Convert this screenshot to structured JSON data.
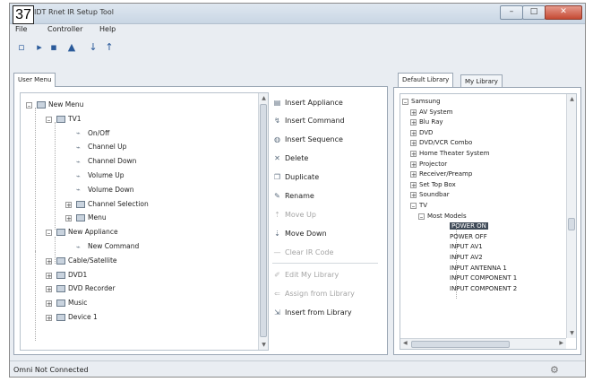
{
  "badge": "37",
  "window": {
    "title": "IDT Rnet IR Setup Tool",
    "controls": {
      "minimize": "–",
      "maximize": "□",
      "close": "✕"
    }
  },
  "menu": [
    "File",
    "Controller",
    "Help"
  ],
  "toolbar": [
    {
      "icon": "new-document-icon",
      "glyph": "▫"
    },
    {
      "icon": "open-icon",
      "glyph": "▸"
    },
    {
      "icon": "save-icon",
      "glyph": "▪"
    },
    {
      "icon": "upload-device-icon",
      "glyph": "▲"
    },
    {
      "icon": "arrow-down-icon",
      "glyph": "↓"
    },
    {
      "icon": "arrow-up-icon",
      "glyph": "↑"
    }
  ],
  "left_tab": "User Menu",
  "user_tree": [
    {
      "label": "New Menu",
      "type": "folder",
      "expander": "–"
    },
    {
      "label": "TV1",
      "type": "folder",
      "expander": "–"
    },
    {
      "label": "On/Off",
      "type": "command"
    },
    {
      "label": "Channel Up",
      "type": "command"
    },
    {
      "label": "Channel Down",
      "type": "command"
    },
    {
      "label": "Volume Up",
      "type": "command"
    },
    {
      "label": "Volume Down",
      "type": "command"
    },
    {
      "label": "Channel Selection",
      "type": "folder",
      "expander": "+"
    },
    {
      "label": "Menu",
      "type": "folder",
      "expander": "+"
    },
    {
      "label": "New Appliance",
      "type": "folder",
      "expander": "–"
    },
    {
      "label": "New Command",
      "type": "command"
    },
    {
      "label": "Cable/Satellite",
      "type": "folder",
      "expander": "+"
    },
    {
      "label": "DVD1",
      "type": "folder",
      "expander": "+"
    },
    {
      "label": "DVD Recorder",
      "type": "folder",
      "expander": "+"
    },
    {
      "label": "Music",
      "type": "folder",
      "expander": "+"
    },
    {
      "label": "Device 1",
      "type": "folder",
      "expander": "+"
    }
  ],
  "actions": [
    {
      "label": "Insert Appliance",
      "icon": "insert-appliance-icon",
      "glyph": "▤",
      "enabled": true
    },
    {
      "label": "Insert Command",
      "icon": "insert-command-icon",
      "glyph": "↯",
      "enabled": true
    },
    {
      "label": "Insert Sequence",
      "icon": "insert-sequence-icon",
      "glyph": "◍",
      "enabled": true
    },
    {
      "label": "Delete",
      "icon": "delete-icon",
      "glyph": "✕",
      "enabled": true
    },
    {
      "label": "Duplicate",
      "icon": "duplicate-icon",
      "glyph": "❐",
      "enabled": true
    },
    {
      "label": "Rename",
      "icon": "rename-icon",
      "glyph": "✎",
      "enabled": true
    },
    {
      "label": "Move Up",
      "icon": "move-up-icon",
      "glyph": "⇡",
      "enabled": false
    },
    {
      "label": "Move Down",
      "icon": "move-down-icon",
      "glyph": "⇣",
      "enabled": true
    },
    {
      "label": "Clear IR Code",
      "icon": "clear-ir-code-icon",
      "glyph": "—",
      "enabled": false
    },
    {
      "label": "Edit My Library",
      "icon": "edit-library-icon",
      "glyph": "✐",
      "enabled": false
    },
    {
      "label": "Assign from Library",
      "icon": "assign-library-icon",
      "glyph": "⇐",
      "enabled": false
    },
    {
      "label": "Insert from Library",
      "icon": "insert-library-icon",
      "glyph": "⇲",
      "enabled": true
    }
  ],
  "right_tabs": [
    "Default Library",
    "My Library"
  ],
  "library_tree": [
    {
      "label": "Samsung",
      "expander": "–"
    },
    {
      "label": "AV System",
      "expander": "+"
    },
    {
      "label": "Blu Ray",
      "expander": "+"
    },
    {
      "label": "DVD",
      "expander": "+"
    },
    {
      "label": "DVD/VCR Combo",
      "expander": "+"
    },
    {
      "label": "Home Theater System",
      "expander": "+"
    },
    {
      "label": "Projector",
      "expander": "+"
    },
    {
      "label": "Receiver/Preamp",
      "expander": "+"
    },
    {
      "label": "Set Top Box",
      "expander": "+"
    },
    {
      "label": "Soundbar",
      "expander": "+"
    },
    {
      "label": "TV",
      "expander": "–"
    },
    {
      "label": "Most Models",
      "expander": "–"
    },
    {
      "label": "POWER ON",
      "selected": true
    },
    {
      "label": "POWER OFF"
    },
    {
      "label": "INPUT AV1"
    },
    {
      "label": "INPUT AV2"
    },
    {
      "label": "INPUT ANTENNA 1"
    },
    {
      "label": "INPUT COMPONENT 1"
    },
    {
      "label": "INPUT COMPONENT 2"
    }
  ],
  "status": "Omni Not Connected",
  "status_icon": "connection-icon"
}
